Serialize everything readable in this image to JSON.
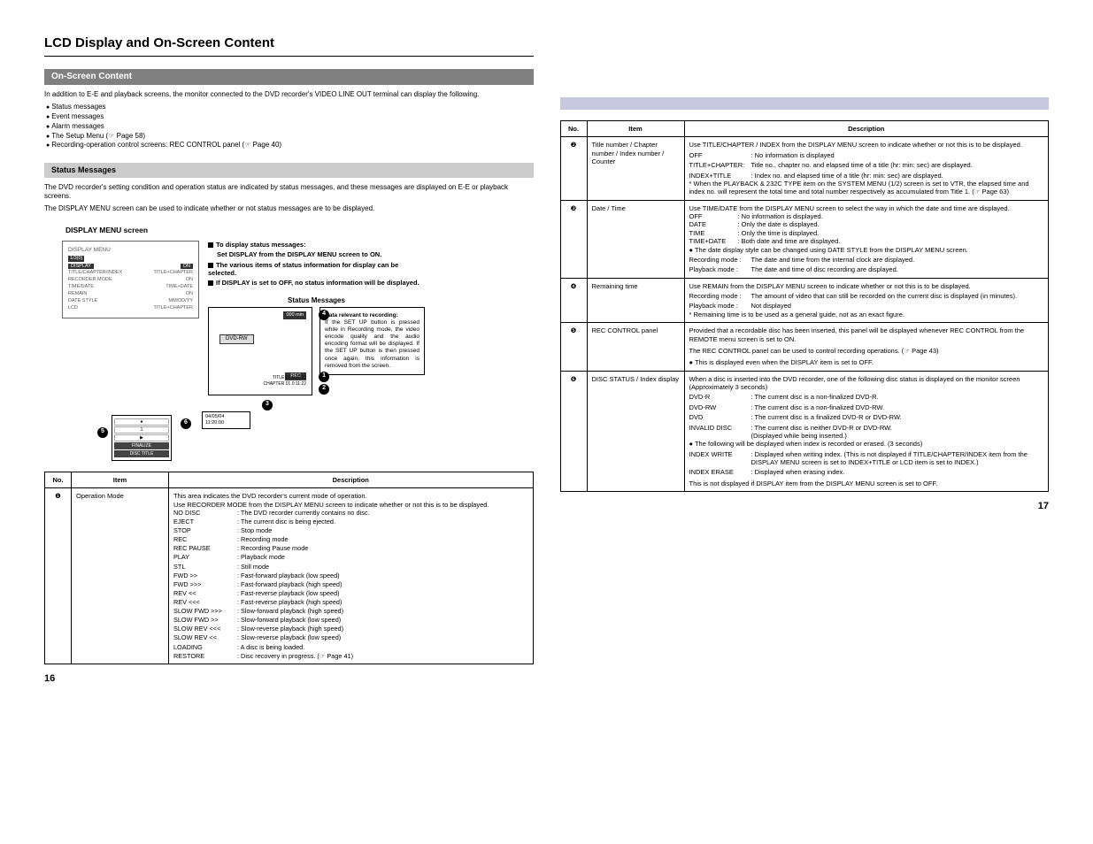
{
  "title": "LCD Display and On-Screen Content",
  "left": {
    "sec1_title": "On-Screen Content",
    "intro": "In addition to E-E and playback screens, the monitor connected to the DVD recorder's VIDEO LINE OUT terminal can display the following.",
    "bullets": [
      "Status messages",
      "Event messages",
      "Alarm messages",
      "The Setup Menu (☞ Page 58)",
      "Recording-operation control screens: REC CONTROL panel (☞ Page 40)"
    ],
    "sec2_title": "Status Messages",
    "status_intro1": "The DVD recorder's setting condition and operation status are indicated by status messages, and these messages are displayed on E-E or playback screens.",
    "status_intro2": "The DISPLAY MENU screen can be used to indicate whether or not status messages are to be displayed.",
    "menu_title": "DISPLAY MENU screen",
    "menu": {
      "t": "DISPLAY MENU",
      "s": "1/3(0)",
      "rows": [
        {
          "l": "DISPLAY",
          "r": "ON"
        },
        {
          "l": "TITLE/CHAPTER/INDEX",
          "r": "TITLE+CHAPTER"
        },
        {
          "l": "RECORDER MODE",
          "r": "ON"
        },
        {
          "l": "TIME/DATE",
          "r": "TIME+DATE"
        },
        {
          "l": "REMAIN",
          "r": "ON"
        },
        {
          "l": "DATE STYLE",
          "r": "MM/DD/YY"
        },
        {
          "l": "LCD",
          "r": "TITLE+CHAPTER"
        }
      ]
    },
    "notes": [
      "To display status messages:",
      "Set DISPLAY from the DISPLAY MENU screen to ON.",
      "The various items of status information for display can be selected.",
      "If DISPLAY is set to OFF, no status information will be displayed."
    ],
    "status_label": "Status Messages",
    "callout_title": "Data relevant to recording:",
    "callout_body": "If the SET UP button is pressed while in Recording mode, the video encode quality and the audio encoding format will be displayed. If the SET UP button is then pressed once again, this information is removed from the screen.",
    "mon_top": "000 min",
    "mon_dvdrw": "DVD-RW",
    "mon_rec": "REC",
    "mon_t1": "TITLE 01   0:11:22",
    "mon_t2": "CHAPTER 01   0:11:22",
    "lcd_rows": [
      "●",
      "1",
      "▶",
      "FINALIZE",
      "DISC TITLE"
    ],
    "lcd_b1": "04/05/04",
    "lcd_b2": "11:20:00",
    "table": {
      "h_no": "No.",
      "h_item": "Item",
      "h_desc": "Description",
      "row1_no": "❶",
      "row1_item": "Operation Mode",
      "row1_p1": "This area indicates the DVD recorder's current mode of operation.",
      "row1_p2": "Use RECORDER MODE from the DISPLAY MENU screen to indicate whether or not this is to be displayed.",
      "modes": [
        [
          "NO DISC",
          ": The DVD recorder currently contains no disc."
        ],
        [
          "EJECT",
          ": The current disc is being ejected."
        ],
        [
          "STOP",
          ": Stop mode"
        ],
        [
          "REC",
          ": Recording mode"
        ],
        [
          "REC PAUSE",
          ": Recording Pause mode"
        ],
        [
          "PLAY",
          ": Playback mode"
        ],
        [
          "STL",
          ": Still mode"
        ],
        [
          "FWD >>",
          ": Fast-forward playback (low speed)"
        ],
        [
          "FWD >>>",
          ": Fast-forward playback (high speed)"
        ],
        [
          "REV <<",
          ": Fast-reverse playback (low speed)"
        ],
        [
          "REV <<<",
          ": Fast-reverse playback (high speed)"
        ],
        [
          "SLOW FWD >>>",
          ": Slow-forward playback (high speed)"
        ],
        [
          "SLOW FWD >>",
          ": Slow-forward playback (low speed)"
        ],
        [
          "SLOW REV <<<",
          ": Slow-reverse playback (high speed)"
        ],
        [
          "SLOW REV <<",
          ": Slow-reverse playback (low speed)"
        ],
        [
          "LOADING",
          ": A disc is being loaded."
        ],
        [
          "RESTORE",
          ": Disc recovery in progress. (☞ Page 41)"
        ]
      ]
    },
    "pagenum": "16"
  },
  "right": {
    "h_no": "No.",
    "h_item": "Item",
    "h_desc": "Description",
    "rows": [
      {
        "no": "❷",
        "item": "Title number / Chapter number / Index number / Counter",
        "p1": "Use TITLE/CHAPTER / INDEX from the DISPLAY MENU screen to indicate whether or not this is to be displayed.",
        "kv": [
          [
            "OFF",
            ": No information is displayed"
          ],
          [
            "TITLE+CHAPTER:",
            "Title no., chapter no. and elapsed time of a title (hr: min: sec) are displayed."
          ],
          [
            "INDEX+TITLE",
            ": Index no. and elapsed time of a title (hr: min: sec) are displayed."
          ]
        ],
        "p2": "* When the PLAYBACK & 232C TYPE item on the SYSTEM MENU (1/2) screen is set to VTR, the elapsed time and index no. will represent the total time and total number respectively as accumulated from Title 1.    (☞ Page 63)"
      },
      {
        "no": "❸",
        "item": "Date / Time",
        "p1": "Use TIME/DATE from the DISPLAY MENU screen to select the way in which the date and time are displayed.",
        "kv": [
          [
            "OFF",
            ": No information is displayed."
          ],
          [
            "DATE",
            ": Only the date is displayed."
          ],
          [
            "TIME",
            ": Only the time is displayed."
          ],
          [
            "TIME+DATE",
            ": Both date and time are displayed."
          ]
        ],
        "b1": "● The date display style can be changed using DATE STYLE from the DISPLAY MENU screen.",
        "kv2": [
          [
            "Recording mode :",
            "The date and time from the internal clock are displayed."
          ],
          [
            "Playback mode   :",
            "The date and time of disc recording are displayed."
          ]
        ]
      },
      {
        "no": "❹",
        "item": "Remaining time",
        "p1": "Use REMAIN from the DISPLAY MENU screen to indicate whether or not this is to be displayed.",
        "kv": [
          [
            "Recording mode :",
            "The amount of video that can still be recorded on the current disc is displayed (in minutes)."
          ],
          [
            "Playback mode   :",
            "Not displayed"
          ]
        ],
        "p2": "* Remaining time is to be used as a general guide, not as an exact figure."
      },
      {
        "no": "❺",
        "item": "REC CONTROL panel",
        "p1": "Provided that a recordable disc has been inserted, this panel will be displayed whenever REC CONTROL from the REMOTE menu screen is set to ON.",
        "p2": "The REC CONTROL panel can be used to control recording operations. (☞ Page 43)",
        "b1": "● This is displayed even when the DISPLAY item is set to OFF."
      },
      {
        "no": "❻",
        "item": "DISC STATUS / Index display",
        "p1": "When a disc is inserted into the DVD recorder, one of the following disc status is displayed on the monitor screen (Approximately 3 seconds)",
        "kv": [
          [
            "DVD-R",
            ": The current disc is a non-finalized DVD-R."
          ],
          [
            "DVD-RW",
            ": The current disc is a non-finalized DVD-RW."
          ],
          [
            "DVD",
            ": The current disc is a finalized DVD-R or DVD-RW."
          ],
          [
            "INVALID DISC",
            ": The current disc is neither DVD-R or DVD-RW."
          ]
        ],
        "p2": "(Displayed while being inserted.)",
        "b1": "● The following will be displayed when index is recorded or erased. (3 seconds)",
        "kv2": [
          [
            "INDEX WRITE",
            ": Displayed when writing index. (This is not displayed if TITLE/CHAPTER/INDEX item from the DISPLAY MENU screen is set to INDEX+TITLE or LCD item is set to INDEX.)"
          ],
          [
            "INDEX ERASE",
            ": Displayed when erasing index."
          ]
        ],
        "p3": "This is not displayed if DISPLAY item from the DISPLAY MENU screen is set to OFF."
      }
    ],
    "pagenum": "17"
  }
}
